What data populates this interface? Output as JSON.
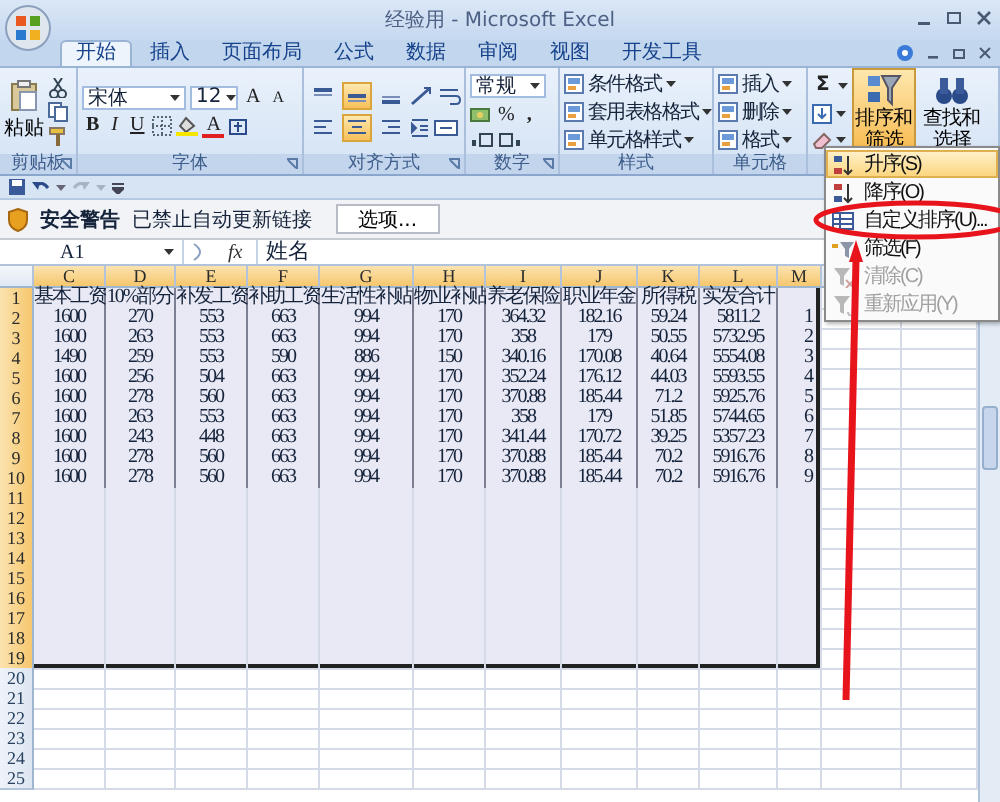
{
  "window": {
    "title": "经验用 - Microsoft Excel"
  },
  "tabs": [
    {
      "label": "开始",
      "selected": true
    },
    {
      "label": "插入",
      "selected": false
    },
    {
      "label": "页面布局",
      "selected": false
    },
    {
      "label": "公式",
      "selected": false
    },
    {
      "label": "数据",
      "selected": false
    },
    {
      "label": "审阅",
      "selected": false
    },
    {
      "label": "视图",
      "selected": false
    },
    {
      "label": "开发工具",
      "selected": false
    }
  ],
  "ribbon": {
    "groups": [
      {
        "kind": "clipboard",
        "label": "剪贴板",
        "paste": "粘贴"
      },
      {
        "kind": "font",
        "label": "字体",
        "font": "宋体",
        "size": "12",
        "grow": "A",
        "shrink": "A",
        "bold": "B",
        "italic": "I",
        "underline": "U",
        "font_color": "A"
      },
      {
        "kind": "alignment",
        "label": "对齐方式",
        "vertical": [
          {
            "kind": "top",
            "selected": false
          },
          {
            "kind": "middle",
            "selected": true
          },
          {
            "kind": "bottom",
            "selected": false
          }
        ],
        "horizontal": [
          {
            "kind": "left",
            "selected": false
          },
          {
            "kind": "center",
            "selected": true
          },
          {
            "kind": "right",
            "selected": false
          }
        ]
      },
      {
        "kind": "number",
        "label": "数字",
        "format": "常规",
        "percent": "%",
        "comma": ","
      },
      {
        "kind": "list",
        "label": "样式",
        "items": [
          "条件格式",
          "套用表格格式",
          "单元格样式"
        ]
      },
      {
        "kind": "list",
        "label": "单元格",
        "items": [
          "插入",
          "删除",
          "格式"
        ]
      },
      {
        "kind": "editing",
        "sum": "Σ",
        "buttons": [
          {
            "label": "排序和筛选",
            "selected": true
          },
          {
            "label": "查找和选择",
            "selected": false
          }
        ]
      }
    ]
  },
  "security_bar": {
    "title": "安全警告",
    "message": "已禁止自动更新链接",
    "button": "选项..."
  },
  "formula_bar": {
    "name_box": "A1",
    "fx": "fx",
    "value": "姓名"
  },
  "sheet": {
    "columns": [
      {
        "label": "C",
        "selected": true
      },
      {
        "label": "D",
        "selected": true
      },
      {
        "label": "E",
        "selected": true
      },
      {
        "label": "F",
        "selected": true
      },
      {
        "label": "G",
        "selected": true
      },
      {
        "label": "H",
        "selected": true
      },
      {
        "label": "I",
        "selected": true
      },
      {
        "label": "J",
        "selected": true
      },
      {
        "label": "K",
        "selected": true
      },
      {
        "label": "L",
        "selected": true
      },
      {
        "label": "M",
        "selected": true
      }
    ],
    "rows": [
      {
        "label": "1",
        "selected": true,
        "cells": [
          "基本工资",
          "10%部分",
          "补发工资",
          "补助工资",
          "生活性补贴",
          "物业补贴",
          "养老保险",
          "职业年金",
          "所得税",
          "实发合计"
        ]
      },
      {
        "label": "2",
        "selected": true,
        "cells": [
          "1600",
          "270",
          "553",
          "663",
          "994",
          "170",
          "364.32",
          "182.16",
          "59.24",
          "5811.2",
          "1"
        ]
      },
      {
        "label": "3",
        "selected": true,
        "cells": [
          "1600",
          "263",
          "553",
          "663",
          "994",
          "170",
          "358",
          "179",
          "50.55",
          "5732.95",
          "2"
        ]
      },
      {
        "label": "4",
        "selected": true,
        "cells": [
          "1490",
          "259",
          "553",
          "590",
          "886",
          "150",
          "340.16",
          "170.08",
          "40.64",
          "5554.08",
          "3"
        ]
      },
      {
        "label": "5",
        "selected": true,
        "cells": [
          "1600",
          "256",
          "504",
          "663",
          "994",
          "170",
          "352.24",
          "176.12",
          "44.03",
          "5593.55",
          "4"
        ]
      },
      {
        "label": "6",
        "selected": true,
        "cells": [
          "1600",
          "278",
          "560",
          "663",
          "994",
          "170",
          "370.88",
          "185.44",
          "71.2",
          "5925.76",
          "5"
        ]
      },
      {
        "label": "7",
        "selected": true,
        "cells": [
          "1600",
          "263",
          "553",
          "663",
          "994",
          "170",
          "358",
          "179",
          "51.85",
          "5744.65",
          "6"
        ]
      },
      {
        "label": "8",
        "selected": true,
        "cells": [
          "1600",
          "243",
          "448",
          "663",
          "994",
          "170",
          "341.44",
          "170.72",
          "39.25",
          "5357.23",
          "7"
        ]
      },
      {
        "label": "9",
        "selected": true,
        "cells": [
          "1600",
          "278",
          "560",
          "663",
          "994",
          "170",
          "370.88",
          "185.44",
          "70.2",
          "5916.76",
          "8"
        ]
      },
      {
        "label": "10",
        "selected": true,
        "cells": [
          "1600",
          "278",
          "560",
          "663",
          "994",
          "170",
          "370.88",
          "185.44",
          "70.2",
          "5916.76",
          "9"
        ]
      },
      {
        "label": "11",
        "selected": true
      },
      {
        "label": "12",
        "selected": true
      },
      {
        "label": "13",
        "selected": true
      },
      {
        "label": "14",
        "selected": true
      },
      {
        "label": "15",
        "selected": true
      },
      {
        "label": "16",
        "selected": true
      },
      {
        "label": "17",
        "selected": true
      },
      {
        "label": "18",
        "selected": true
      },
      {
        "label": "19",
        "selected": true
      },
      {
        "label": "20",
        "selected": false
      },
      {
        "label": "21",
        "selected": false
      },
      {
        "label": "22",
        "selected": false
      },
      {
        "label": "23",
        "selected": false
      },
      {
        "label": "24",
        "selected": false
      },
      {
        "label": "25",
        "selected": false
      }
    ]
  },
  "sort_menu": {
    "items": [
      {
        "kind": "ascending",
        "label": "升序(S)",
        "selected": true,
        "disabled": false
      },
      {
        "kind": "descending",
        "label": "降序(O)",
        "selected": false,
        "disabled": false
      },
      {
        "kind": "custom",
        "label": "自定义排序(U)...",
        "selected": false,
        "disabled": false
      },
      {
        "kind": "filter",
        "label": "筛选(F)",
        "selected": false,
        "disabled": false
      },
      {
        "kind": "clear",
        "label": "清除(C)",
        "selected": false,
        "disabled": true
      },
      {
        "kind": "reapply",
        "label": "重新应用(Y)",
        "selected": false,
        "disabled": true
      }
    ]
  }
}
